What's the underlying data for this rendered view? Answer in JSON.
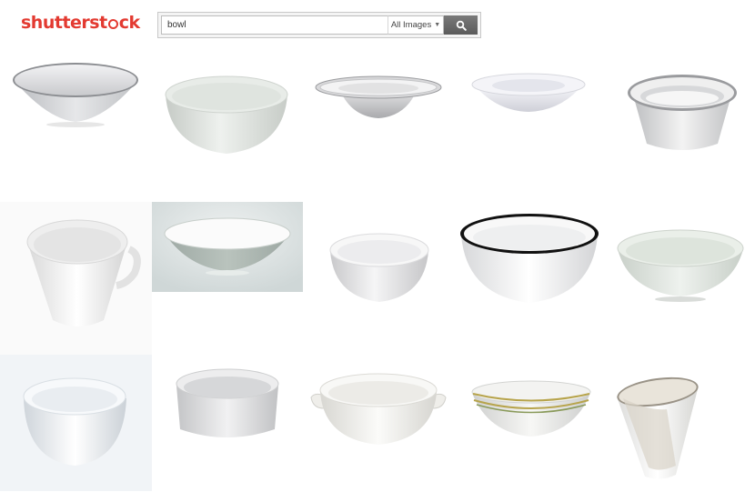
{
  "header": {
    "logo_parts": [
      "shutterst",
      "ck"
    ],
    "search": {
      "value": "bowl",
      "placeholder": ""
    },
    "scope_label": "All Images",
    "search_icon": "search-icon"
  },
  "results": {
    "rows": [
      [
        "wide-white-bowl",
        "deep-white-bowl",
        "rimmed-white-bowl",
        "shallow-white-plate-bowl",
        "ribbed-rim-bowl"
      ],
      [
        "white-cup",
        "wide-bowl-grey-background",
        "small-white-bowl",
        "black-rim-enamel-bowl",
        "pale-green-bowl"
      ],
      [
        "round-white-bowl",
        "straight-side-bowl",
        "handled-white-bowl",
        "gold-stripe-bowl",
        "tall-white-cup"
      ]
    ]
  },
  "colors": {
    "brand": "#e33a31",
    "search_button": "#666666"
  }
}
